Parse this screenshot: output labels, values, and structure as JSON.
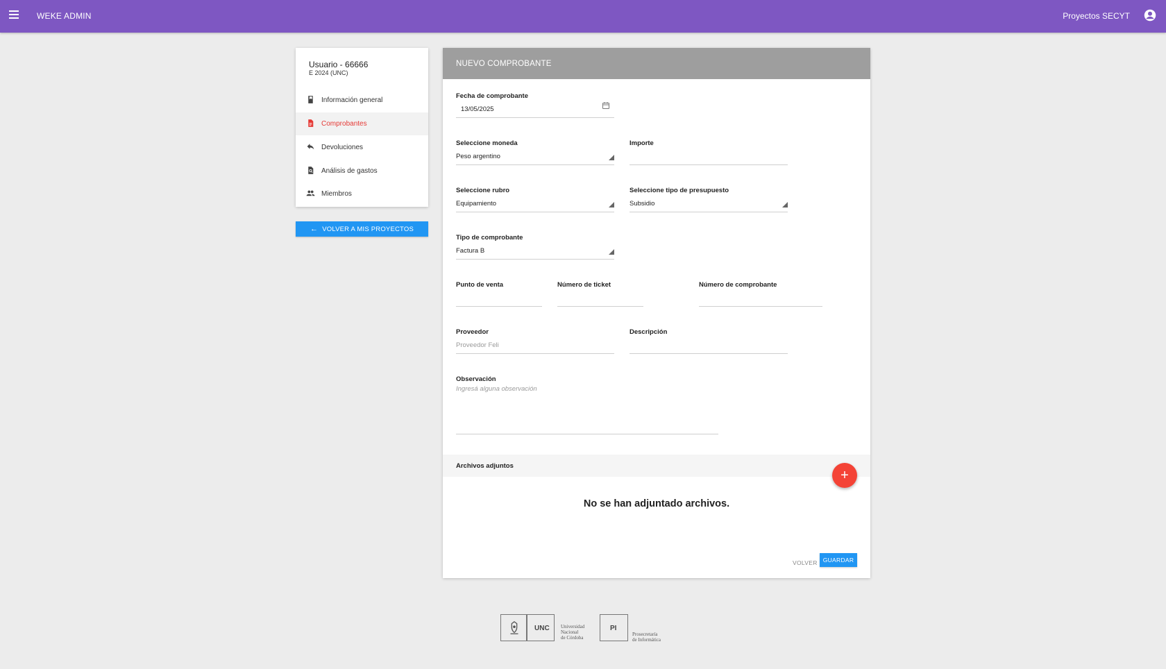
{
  "topbar": {
    "app_title": "WEKE ADMIN",
    "project_title": "Proyectos SECYT",
    "color": "#7e57c2"
  },
  "sidebar": {
    "user_title": "Usuario - 66666",
    "user_subtitle": "E 2024 (UNC)",
    "items": [
      {
        "label": "Información general",
        "icon": "book-icon",
        "active": false
      },
      {
        "label": "Comprobantes",
        "icon": "document-icon",
        "active": true
      },
      {
        "label": "Devoluciones",
        "icon": "reply-icon",
        "active": false
      },
      {
        "label": "Análisis de gastos",
        "icon": "search-document-icon",
        "active": false
      },
      {
        "label": "Miembros",
        "icon": "people-icon",
        "active": false
      }
    ],
    "back_button": "VOLVER A MIS PROYECTOS"
  },
  "form": {
    "header": "NUEVO COMPROBANTE",
    "fecha": {
      "label": "Fecha de comprobante",
      "value": "13/05/2025"
    },
    "moneda": {
      "label": "Seleccione moneda",
      "value": "Peso argentino"
    },
    "importe": {
      "label": "Importe",
      "value": ""
    },
    "rubro": {
      "label": "Seleccione rubro",
      "value": "Equipamiento"
    },
    "presupuesto": {
      "label": "Seleccione tipo de presupuesto",
      "value": "Subsidio"
    },
    "tipo": {
      "label": "Tipo de comprobante",
      "value": "Factura B"
    },
    "punto_venta": {
      "label": "Punto de venta",
      "value": ""
    },
    "numero_ticket": {
      "label": "Número de ticket",
      "value": ""
    },
    "numero_comprobante": {
      "label": "Número de comprobante",
      "value": ""
    },
    "proveedor": {
      "label": "Proveedor",
      "placeholder": "Proveedor Feli"
    },
    "descripcion": {
      "label": "Descripción",
      "value": ""
    },
    "observacion": {
      "label": "Observación",
      "placeholder": "Ingresá alguna observación"
    },
    "attachments_title": "Archivos adjuntos",
    "no_files": "No se han adjuntado archivos.",
    "add_button": "+",
    "volver": "VOLVER",
    "guardar": "GUARDAR",
    "accent_blue": "#2196f3",
    "accent_red": "#f44336"
  },
  "footer": {
    "unc": "UNC",
    "unc_name": "Universidad\nNacional\nde Córdoba",
    "pi": "PI",
    "pi_name": "Prosecretaría\nde Informática"
  }
}
